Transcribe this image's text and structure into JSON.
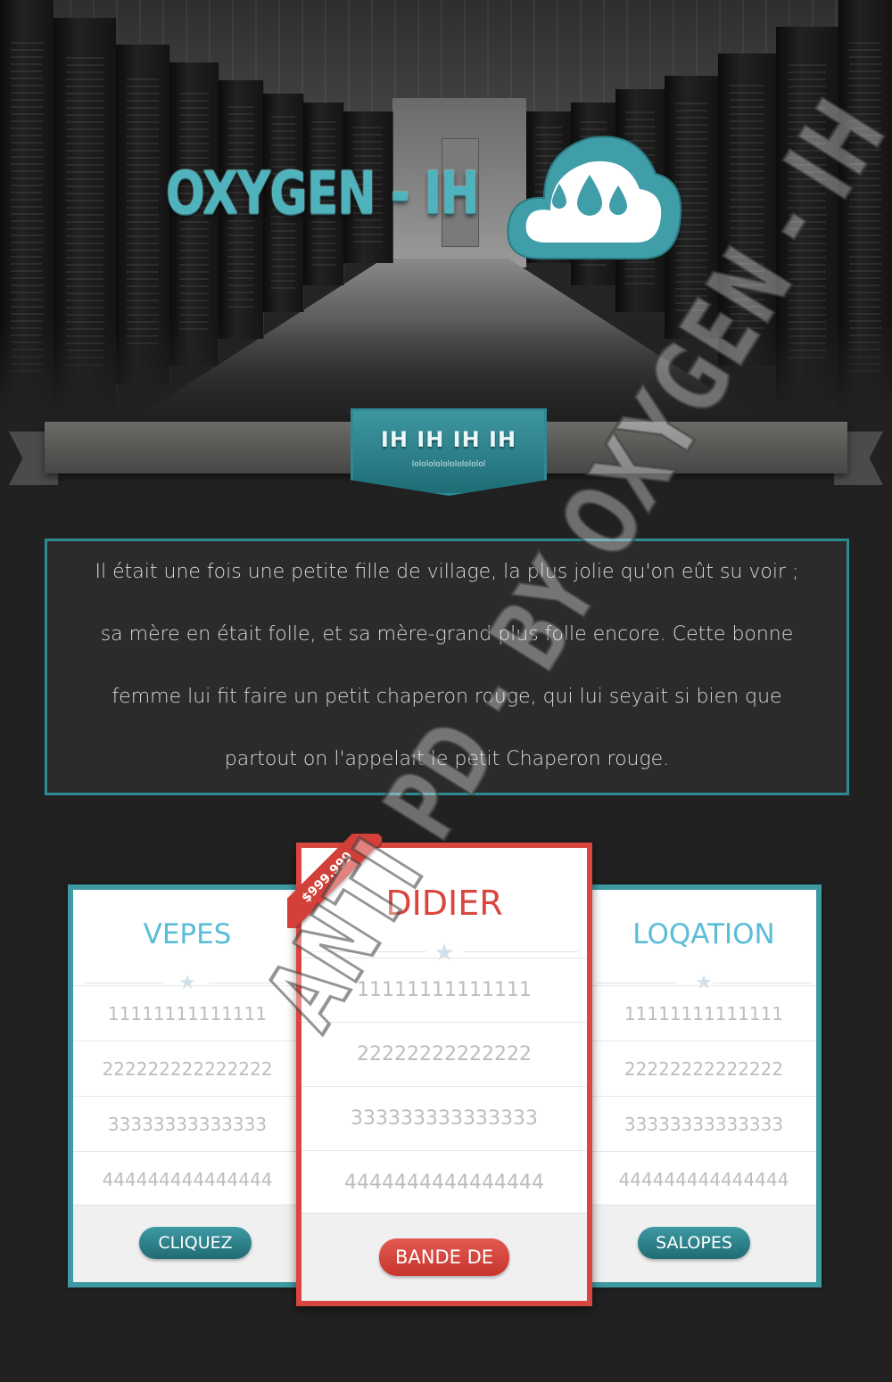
{
  "header": {
    "logo_text": "OXYGEN - IH",
    "logo_icon": "cloud-rain-icon"
  },
  "ribbon": {
    "badge_title": "IH IH IH IH",
    "badge_subtitle": "lolololololololololol"
  },
  "story": {
    "lines": [
      "Il était une fois une petite fille de village, la plus jolie qu'on eût su voir ;",
      "sa mère en était folle, et sa mère-grand plus folle encore. Cette bonne",
      "femme lui fit faire un petit chaperon rouge, qui lui seyait si bien que",
      "partout on l'appelait le petit Chaperon rouge."
    ]
  },
  "pricing": {
    "price_tag": "$999.999",
    "cards": [
      {
        "title": "VEPES",
        "rows": [
          "11111111111111",
          "222222222222222",
          "33333333333333",
          "444444444444444"
        ],
        "button": "CLIQUEZ"
      },
      {
        "title": "DIDIER",
        "rows": [
          "11111111111111",
          "22222222222222",
          "333333333333333",
          "4444444444444444"
        ],
        "button": "BANDE DE"
      },
      {
        "title": "LOQATION",
        "rows": [
          "11111111111111",
          "22222222222222",
          "33333333333333",
          "444444444444444"
        ],
        "button": "SALOPES"
      }
    ]
  },
  "watermark": {
    "text": "ANTI PD - BY OXYGEN - IH"
  },
  "colors": {
    "teal": "#3d9aa3",
    "red": "#d9463f",
    "background": "#212121"
  }
}
